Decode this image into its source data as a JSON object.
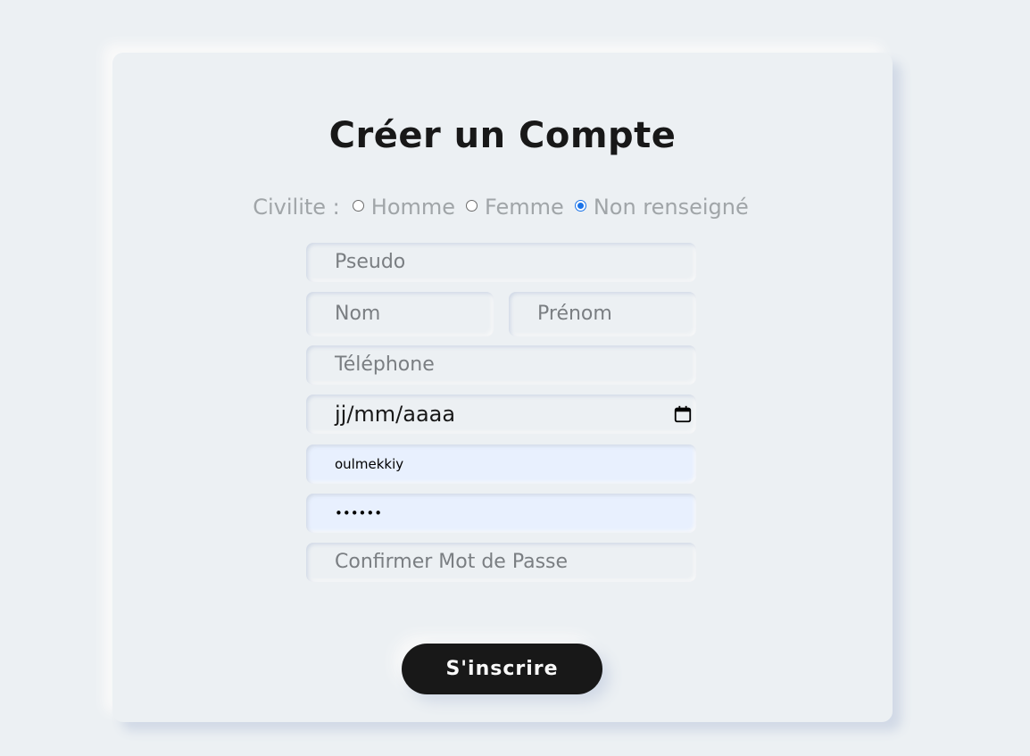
{
  "form": {
    "title": "Créer un Compte",
    "civilite": {
      "label": "Civilite :",
      "options": [
        "Homme",
        "Femme",
        "Non renseigné"
      ],
      "selected": "Non renseigné"
    },
    "fields": {
      "pseudo_placeholder": "Pseudo",
      "nom_placeholder": "Nom",
      "prenom_placeholder": "Prénom",
      "telephone_placeholder": "Téléphone",
      "date_placeholder": "jj/mm/aaaa",
      "email_value": "oulmekkiy",
      "password_value": "••••••",
      "confirm_placeholder": "Confirmer Mot de Passe"
    },
    "submit_label": "S'inscrire"
  },
  "icons": {
    "calendar": "calendar-icon"
  },
  "colors": {
    "background": "#ecf0f3",
    "button": "#181818",
    "radio_selected": "#1a73e8",
    "autofill": "#e8f0fe"
  }
}
